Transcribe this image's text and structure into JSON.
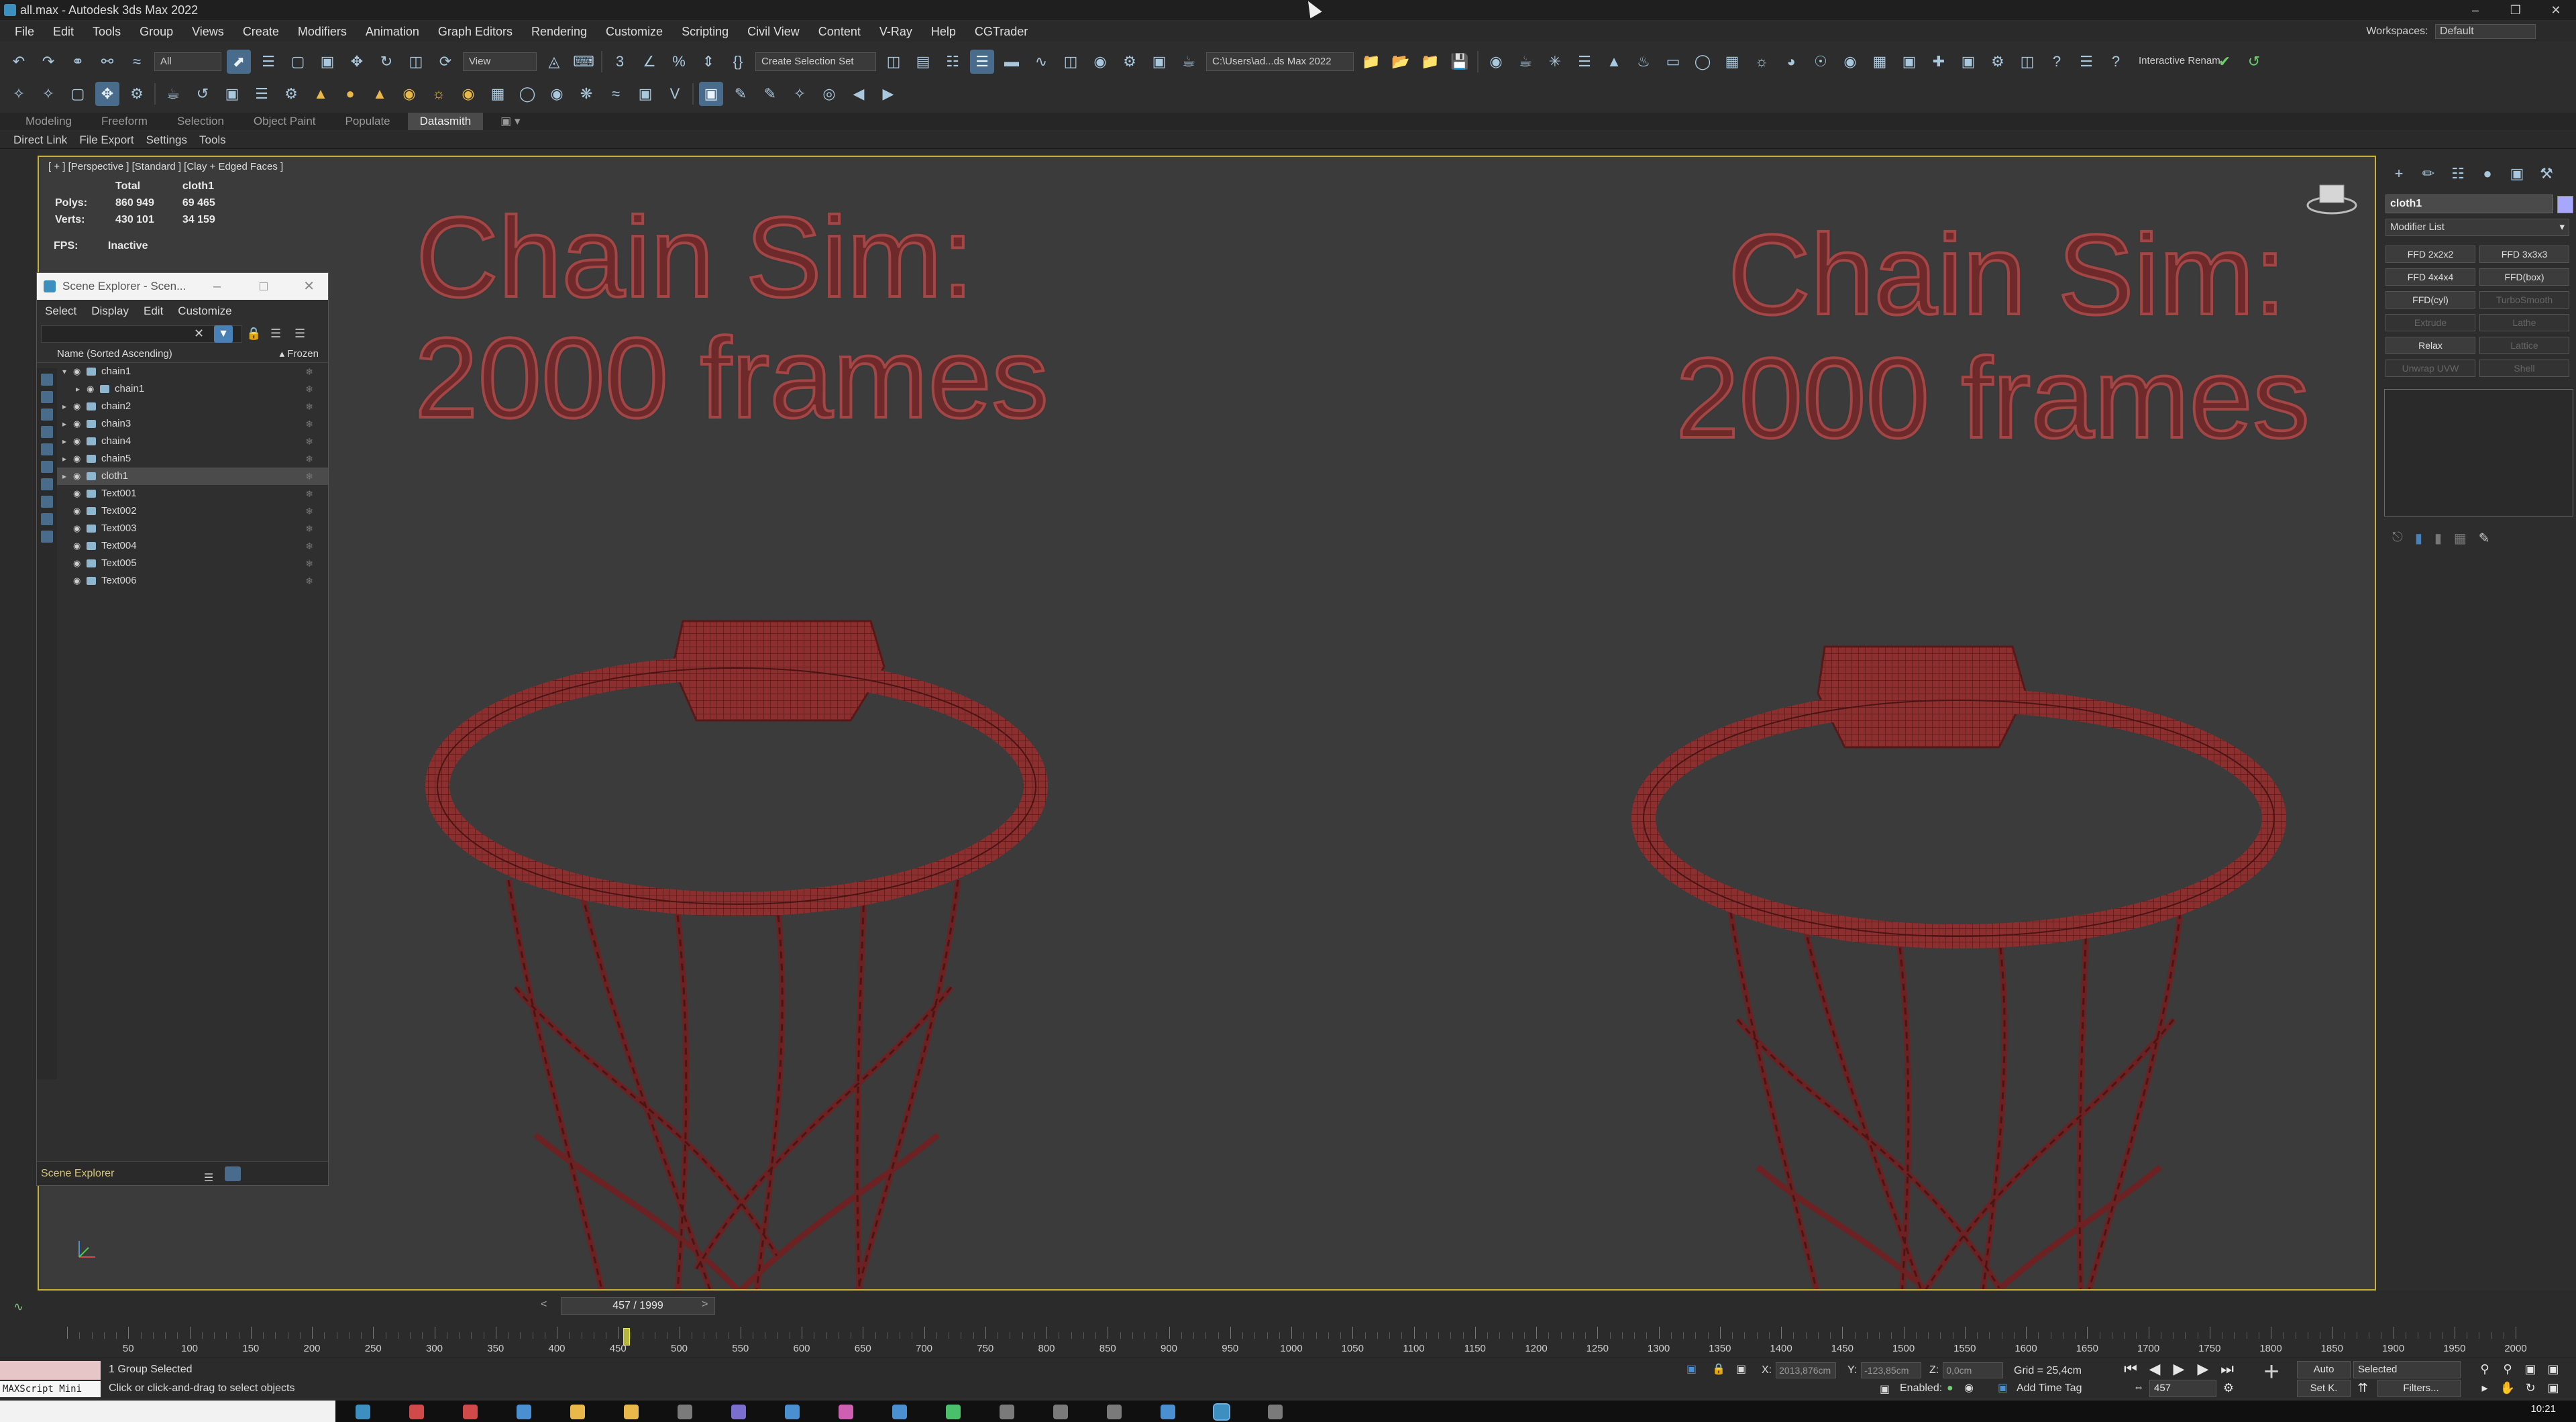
{
  "window": {
    "title": "all.max - Autodesk 3ds Max 2022"
  },
  "menu": [
    "File",
    "Edit",
    "Tools",
    "Group",
    "Views",
    "Create",
    "Modifiers",
    "Animation",
    "Graph Editors",
    "Rendering",
    "Customize",
    "Scripting",
    "Civil View",
    "Content",
    "V-Ray",
    "Help",
    "CGTrader"
  ],
  "workspaces": {
    "label": "Workspaces:",
    "value": "Default"
  },
  "toolbar": {
    "filter": "All",
    "ref_coord": "View",
    "selection_set": "Create Selection Set",
    "project_path": "C:\\Users\\ad...ds Max 2022",
    "interactive_label": "Interactive Renam"
  },
  "ribbon": {
    "tabs": [
      "Modeling",
      "Freeform",
      "Selection",
      "Object Paint",
      "Populate",
      "Datasmith"
    ],
    "active": "Datasmith"
  },
  "subbar": [
    "Direct Link",
    "File Export",
    "Settings",
    "Tools"
  ],
  "viewport": {
    "label": "[ + ] [Perspective ] [Standard ] [Clay + Edged Faces ]",
    "stats": {
      "h_total": "Total",
      "h_obj": "cloth1",
      "polys_label": "Polys:",
      "polys_total": "860 949",
      "polys_obj": "69 465",
      "verts_label": "Verts:",
      "verts_total": "430 101",
      "verts_obj": "34 159"
    },
    "fps_label": "FPS:",
    "fps_value": "Inactive",
    "text_left": [
      "Chain Sim:",
      "2000 frames"
    ],
    "text_right": [
      "Chain Sim:",
      "2000 frames"
    ]
  },
  "scene_explorer": {
    "title": "Scene Explorer - Scen...",
    "menu": [
      "Select",
      "Display",
      "Edit",
      "Customize"
    ],
    "header": "Name (Sorted Ascending)",
    "frozen_header": "▴ Frozen",
    "rows": [
      {
        "name": "chain1",
        "level": 0,
        "expanded": true
      },
      {
        "name": "chain1",
        "level": 1
      },
      {
        "name": "chain2",
        "level": 0
      },
      {
        "name": "chain3",
        "level": 0
      },
      {
        "name": "chain4",
        "level": 0
      },
      {
        "name": "chain5",
        "level": 0
      },
      {
        "name": "cloth1",
        "level": 0,
        "selected": true
      },
      {
        "name": "Text001",
        "level": 0
      },
      {
        "name": "Text002",
        "level": 0
      },
      {
        "name": "Text003",
        "level": 0
      },
      {
        "name": "Text004",
        "level": 0
      },
      {
        "name": "Text005",
        "level": 0
      },
      {
        "name": "Text006",
        "level": 0
      }
    ],
    "footer": "Scene Explorer"
  },
  "command_panel": {
    "object_name": "cloth1",
    "modifier_list": "Modifier List",
    "buttons": [
      {
        "label": "FFD 2x2x2",
        "enabled": true
      },
      {
        "label": "FFD 3x3x3",
        "enabled": true
      },
      {
        "label": "FFD 4x4x4",
        "enabled": true
      },
      {
        "label": "FFD(box)",
        "enabled": true
      },
      {
        "label": "FFD(cyl)",
        "enabled": true
      },
      {
        "label": "TurboSmooth",
        "enabled": false
      },
      {
        "label": "Extrude",
        "enabled": false
      },
      {
        "label": "Lathe",
        "enabled": false
      },
      {
        "label": "Relax",
        "enabled": true
      },
      {
        "label": "Lattice",
        "enabled": false
      },
      {
        "label": "Unwrap UVW",
        "enabled": false
      },
      {
        "label": "Shell",
        "enabled": false
      }
    ]
  },
  "time_slider": {
    "frame_label": "457 / 1999",
    "current_frame": 457,
    "range": [
      0,
      2000
    ],
    "ticks": [
      50,
      100,
      150,
      200,
      250,
      300,
      350,
      400,
      450,
      500,
      550,
      600,
      650,
      700,
      750,
      800,
      850,
      900,
      950,
      1000,
      1050,
      1100,
      1150,
      1200,
      1250,
      1300,
      1350,
      1400,
      1450,
      1500,
      1550,
      1600,
      1650,
      1700,
      1750,
      1800,
      1850,
      1900,
      1950,
      2000
    ]
  },
  "status": {
    "selection": "1 Group Selected",
    "prompt": "Click or click-and-drag to select objects",
    "maxscript": "MAXScript Mini",
    "x_label": "X:",
    "x_value": "2013,876cm",
    "y_label": "Y:",
    "y_value": "-123,85cm",
    "z_label": "Z:",
    "z_value": "0,0cm",
    "grid": "Grid = 25,4cm",
    "enabled": "Enabled:",
    "add_time_tag": "Add Time Tag",
    "auto": "Auto",
    "set_key": "Set K.",
    "selected": "Selected",
    "filters": "Filters...",
    "frame_field": "457",
    "clock": "10:21"
  }
}
